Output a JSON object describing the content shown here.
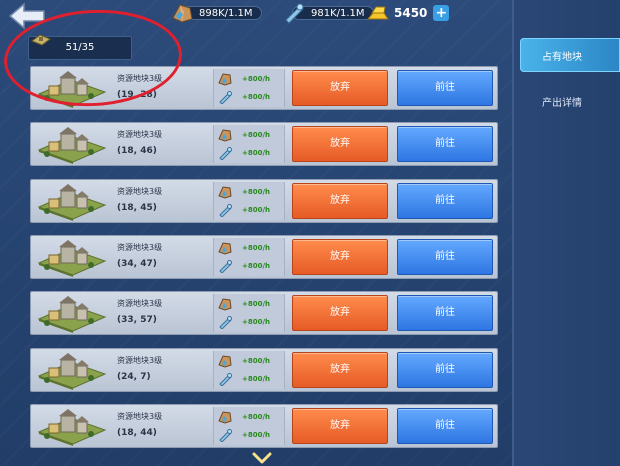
{
  "top_bar": {
    "resources": [
      {
        "icon": "stone-ore-icon",
        "value": "898K/1.1M"
      },
      {
        "icon": "crystal-wrench-icon",
        "value": "981K/1.1M"
      }
    ],
    "gold": {
      "icon": "gold-bars-icon",
      "value": "5450"
    },
    "plus_label": "+"
  },
  "occupied": {
    "count": "51/35"
  },
  "plots": [
    {
      "name": "资源地块3级",
      "coords": "(19, 28)",
      "rate1": "+800/h",
      "rate2": "+800/h",
      "abandon": "放弃",
      "goto": "前往"
    },
    {
      "name": "资源地块3级",
      "coords": "(18, 46)",
      "rate1": "+800/h",
      "rate2": "+800/h",
      "abandon": "放弃",
      "goto": "前往"
    },
    {
      "name": "资源地块3级",
      "coords": "(18, 45)",
      "rate1": "+800/h",
      "rate2": "+800/h",
      "abandon": "放弃",
      "goto": "前往"
    },
    {
      "name": "资源地块3级",
      "coords": "(34, 47)",
      "rate1": "+800/h",
      "rate2": "+800/h",
      "abandon": "放弃",
      "goto": "前往"
    },
    {
      "name": "资源地块3级",
      "coords": "(33, 57)",
      "rate1": "+800/h",
      "rate2": "+800/h",
      "abandon": "放弃",
      "goto": "前往"
    },
    {
      "name": "资源地块3级",
      "coords": "(24, 7)",
      "rate1": "+800/h",
      "rate2": "+800/h",
      "abandon": "放弃",
      "goto": "前往"
    },
    {
      "name": "资源地块3级",
      "coords": "(18, 44)",
      "rate1": "+800/h",
      "rate2": "+800/h",
      "abandon": "放弃",
      "goto": "前往"
    }
  ],
  "side_tabs": [
    {
      "label": "占有地块",
      "active": true
    },
    {
      "label": "产出详情",
      "active": false
    }
  ],
  "colors": {
    "abandon": "#e65b26",
    "goto": "#2e76e2",
    "highlight": "#e01f2f"
  }
}
